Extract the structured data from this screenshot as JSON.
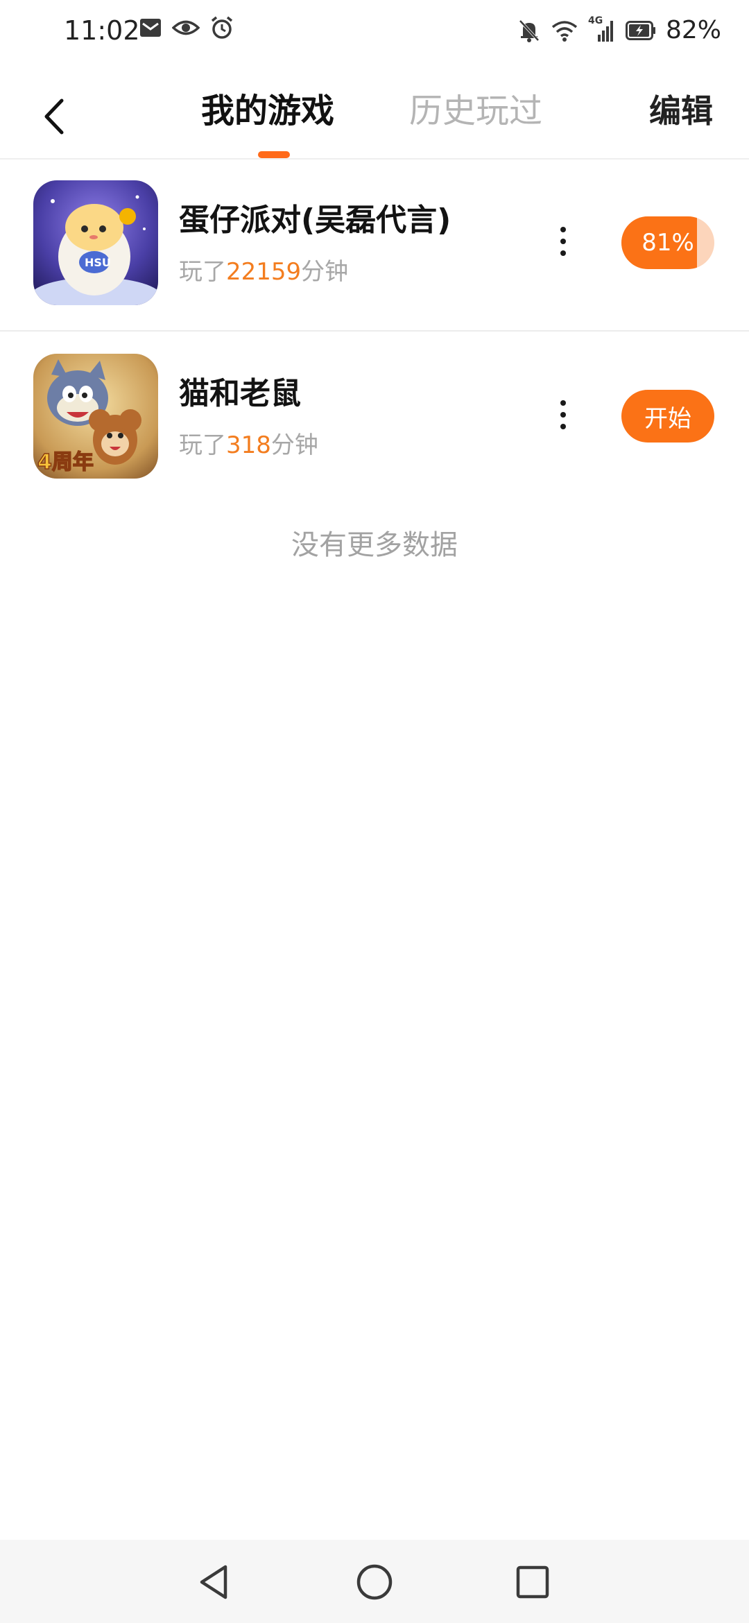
{
  "status_bar": {
    "time": "11:02",
    "battery": "82%",
    "network_label": "4G",
    "icons_left": [
      "mail-icon",
      "eye-icon",
      "alarm-icon"
    ],
    "icons_right": [
      "mute-bell-icon",
      "wifi-icon",
      "signal-icon",
      "battery-icon"
    ]
  },
  "header": {
    "tabs": [
      {
        "label": "我的游戏",
        "active": true
      },
      {
        "label": "历史玩过",
        "active": false
      }
    ],
    "edit_label": "编辑"
  },
  "games": [
    {
      "title": "蛋仔派对(吴磊代言)",
      "played_prefix": "玩了",
      "played_minutes": "22159",
      "played_suffix": "分钟",
      "action": "81%",
      "download_progress": 0.81
    },
    {
      "title": "猫和老鼠",
      "played_prefix": "玩了",
      "played_minutes": "318",
      "played_suffix": "分钟",
      "action": "开始"
    }
  ],
  "footer_text": "没有更多数据",
  "colors": {
    "accent": "#fb7216",
    "accent_light": "#fcd5bb",
    "highlight_number": "#f37d1f",
    "muted_text": "#a7a7a7"
  },
  "nav_bar": [
    "back-triangle-icon",
    "home-circle-icon",
    "recents-square-icon"
  ]
}
